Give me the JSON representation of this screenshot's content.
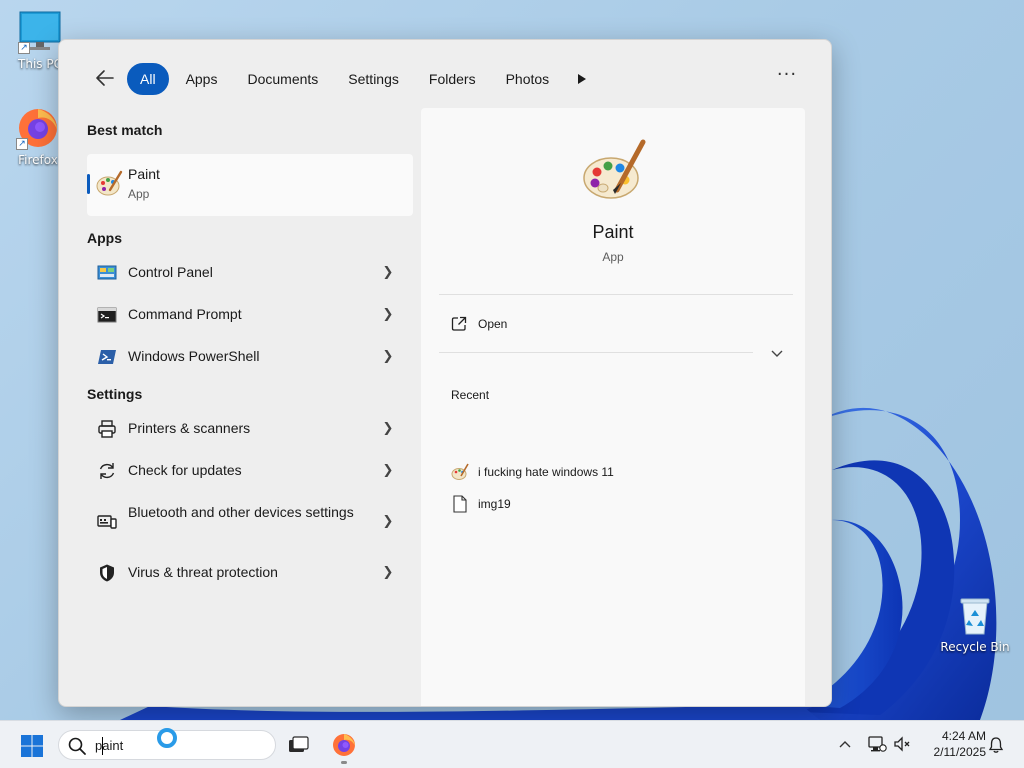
{
  "desktop": {
    "icons": [
      {
        "label": "This PC"
      },
      {
        "label": "Firefox"
      },
      {
        "label": "Recycle Bin"
      }
    ]
  },
  "search_panel": {
    "back_icon": "arrow-left-icon",
    "filters": [
      "All",
      "Apps",
      "Documents",
      "Settings",
      "Folders",
      "Photos"
    ],
    "active_filter": "All",
    "more_filters_icon": "play-icon",
    "more_options_icon": "ellipsis-icon",
    "best_match": {
      "heading": "Best match",
      "title": "Paint",
      "subtitle": "App",
      "icon": "paint-palette-icon"
    },
    "apps": {
      "heading": "Apps",
      "items": [
        {
          "label": "Control Panel",
          "icon": "control-panel-icon"
        },
        {
          "label": "Command Prompt",
          "icon": "command-prompt-icon"
        },
        {
          "label": "Windows PowerShell",
          "icon": "powershell-icon"
        }
      ]
    },
    "settings": {
      "heading": "Settings",
      "items": [
        {
          "label": "Printers & scanners",
          "icon": "printer-icon"
        },
        {
          "label": "Check for updates",
          "icon": "refresh-icon"
        },
        {
          "label": "Bluetooth and other devices settings",
          "icon": "devices-icon"
        },
        {
          "label": "Virus & threat protection",
          "icon": "shield-icon"
        }
      ]
    },
    "detail": {
      "title": "Paint",
      "subtitle": "App",
      "open_label": "Open",
      "recent_heading": "Recent",
      "recent_items": [
        {
          "label": "i fucking hate windows 11",
          "icon": "paint-palette-icon"
        },
        {
          "label": "img19",
          "icon": "document-icon"
        }
      ]
    }
  },
  "taskbar": {
    "search_value": "paint",
    "time": "4:24 AM",
    "date": "2/11/2025"
  },
  "colors": {
    "accent": "#0a5bbd",
    "wallpaper_blue": "#1a4fd0",
    "panel_bg": "#eeeeee"
  }
}
